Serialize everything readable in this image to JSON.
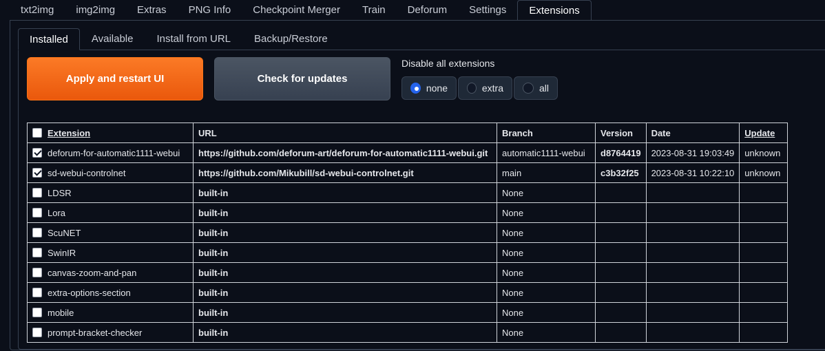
{
  "top_tabs": [
    "txt2img",
    "img2img",
    "Extras",
    "PNG Info",
    "Checkpoint Merger",
    "Train",
    "Deforum",
    "Settings",
    "Extensions"
  ],
  "active_top_tab": "Extensions",
  "sub_tabs": [
    "Installed",
    "Available",
    "Install from URL",
    "Backup/Restore"
  ],
  "active_sub_tab": "Installed",
  "buttons": {
    "apply": "Apply and restart UI",
    "check": "Check for updates"
  },
  "disable_group": {
    "label": "Disable all extensions",
    "options": [
      "none",
      "extra",
      "all"
    ],
    "selected": "none"
  },
  "table": {
    "headers": {
      "extension": "Extension",
      "url": "URL",
      "branch": "Branch",
      "version": "Version",
      "date": "Date",
      "update": "Update"
    },
    "rows": [
      {
        "checked": true,
        "name": "deforum-for-automatic1111-webui",
        "url": "https://github.com/deforum-art/deforum-for-automatic1111-webui.git",
        "branch": "automatic1111-webui",
        "version": "d8764419",
        "date": "2023-08-31 19:03:49",
        "update": "unknown"
      },
      {
        "checked": true,
        "name": "sd-webui-controlnet",
        "url": "https://github.com/Mikubill/sd-webui-controlnet.git",
        "branch": "main",
        "version": "c3b32f25",
        "date": "2023-08-31 10:22:10",
        "update": "unknown"
      },
      {
        "checked": false,
        "name": "LDSR",
        "url": "built-in",
        "branch": "None",
        "version": "",
        "date": "",
        "update": ""
      },
      {
        "checked": false,
        "name": "Lora",
        "url": "built-in",
        "branch": "None",
        "version": "",
        "date": "",
        "update": ""
      },
      {
        "checked": false,
        "name": "ScuNET",
        "url": "built-in",
        "branch": "None",
        "version": "",
        "date": "",
        "update": ""
      },
      {
        "checked": false,
        "name": "SwinIR",
        "url": "built-in",
        "branch": "None",
        "version": "",
        "date": "",
        "update": ""
      },
      {
        "checked": false,
        "name": "canvas-zoom-and-pan",
        "url": "built-in",
        "branch": "None",
        "version": "",
        "date": "",
        "update": ""
      },
      {
        "checked": false,
        "name": "extra-options-section",
        "url": "built-in",
        "branch": "None",
        "version": "",
        "date": "",
        "update": ""
      },
      {
        "checked": false,
        "name": "mobile",
        "url": "built-in",
        "branch": "None",
        "version": "",
        "date": "",
        "update": ""
      },
      {
        "checked": false,
        "name": "prompt-bracket-checker",
        "url": "built-in",
        "branch": "None",
        "version": "",
        "date": "",
        "update": ""
      }
    ]
  },
  "colors": {
    "background": "#0b0f19",
    "apply_button": "#ea580c",
    "check_button": "#4b5563",
    "radio_selected": "#2563eb",
    "border": "#374151"
  }
}
